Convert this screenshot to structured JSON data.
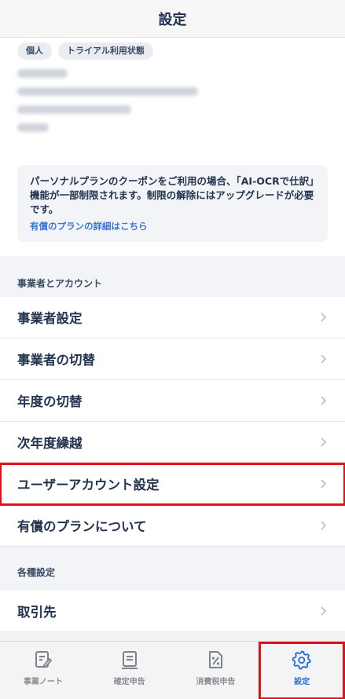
{
  "header": {
    "title": "設定"
  },
  "profile": {
    "chips": [
      "個人",
      "トライアル利用状態"
    ]
  },
  "notice": {
    "text": "パーソナルプランのクーポンをご利用の場合、「AI-OCRで仕訳」機能が一部制限されます。制限の解除にはアップグレードが必要です。",
    "link": "有償のプランの詳細はこちら"
  },
  "sections": [
    {
      "label": "事業者とアカウント",
      "items": [
        "事業者設定",
        "事業者の切替",
        "年度の切替",
        "次年度繰越",
        "ユーザーアカウント設定",
        "有償のプランについて"
      ]
    },
    {
      "label": "各種設定",
      "items": [
        "取引先"
      ]
    }
  ],
  "tabbar": {
    "tabs": [
      {
        "label": "事業ノート",
        "icon": "note-edit-icon"
      },
      {
        "label": "確定申告",
        "icon": "document-icon"
      },
      {
        "label": "消費税申告",
        "icon": "tax-percent-icon"
      },
      {
        "label": "設定",
        "icon": "gear-icon",
        "active": true
      }
    ]
  },
  "colors": {
    "accent": "#2a6fd6",
    "highlight": "#e0111b",
    "text": "#23344f",
    "link": "#3777d8"
  }
}
